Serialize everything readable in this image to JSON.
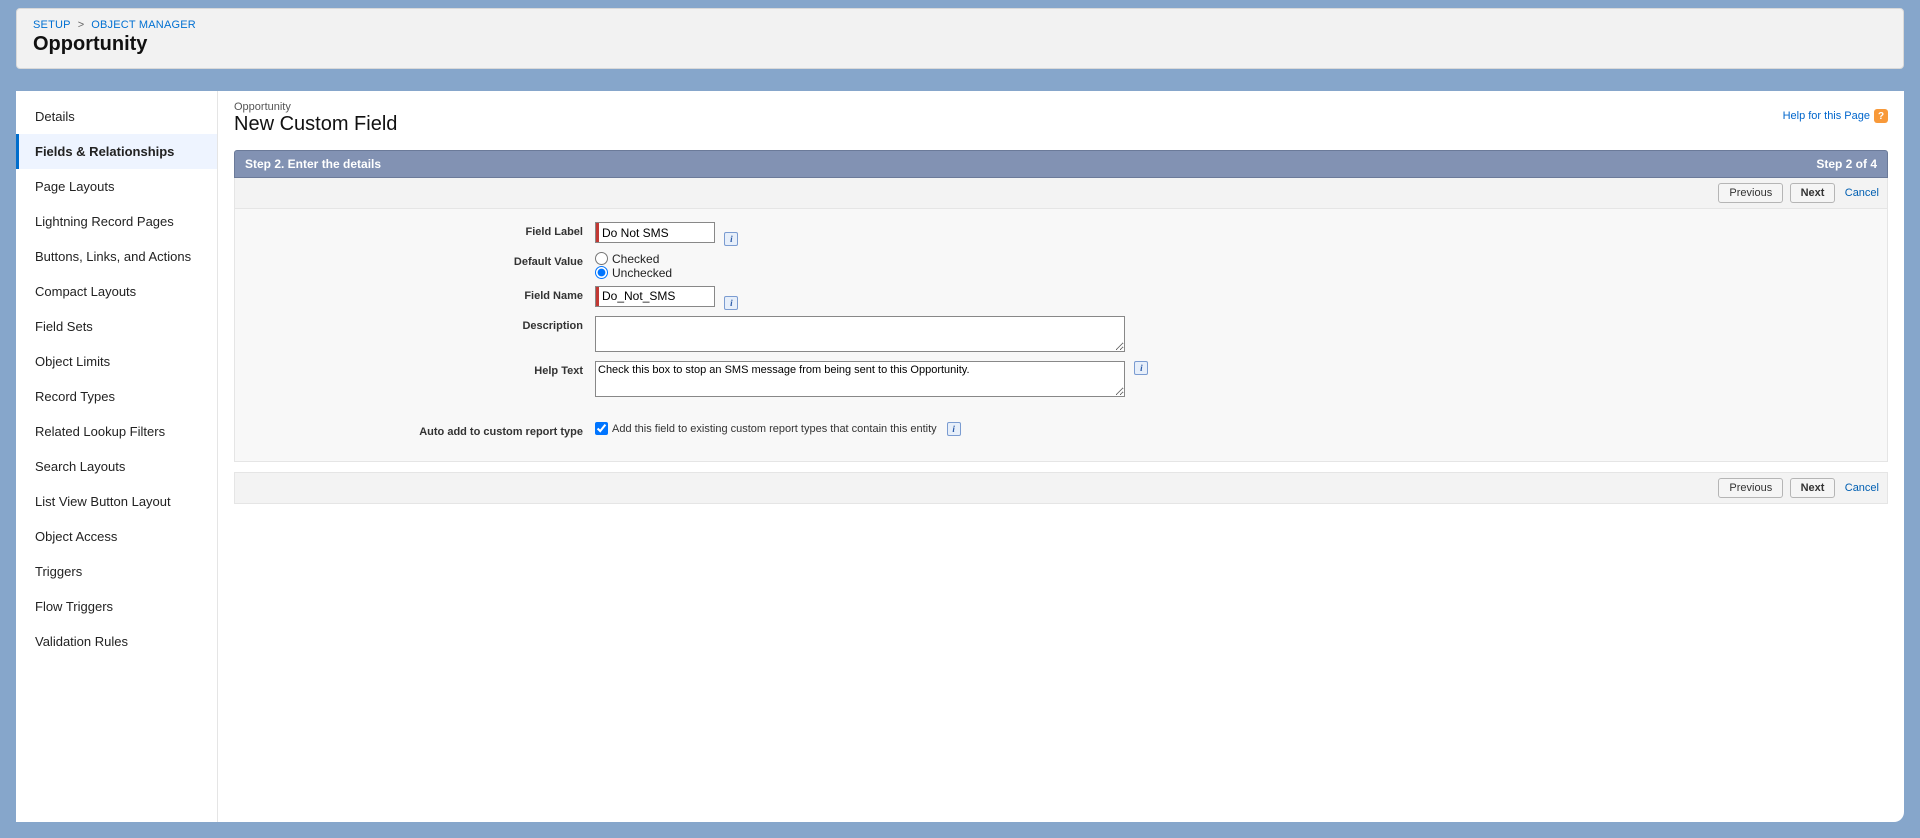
{
  "breadcrumb": {
    "setup": "SETUP",
    "object_manager": "OBJECT MANAGER",
    "sep": ">"
  },
  "page_object": "Opportunity",
  "sidebar": {
    "items": [
      "Details",
      "Fields & Relationships",
      "Page Layouts",
      "Lightning Record Pages",
      "Buttons, Links, and Actions",
      "Compact Layouts",
      "Field Sets",
      "Object Limits",
      "Record Types",
      "Related Lookup Filters",
      "Search Layouts",
      "List View Button Layout",
      "Object Access",
      "Triggers",
      "Flow Triggers",
      "Validation Rules"
    ],
    "active_index": 1
  },
  "content": {
    "sub_breadcrumb": "Opportunity",
    "page_title": "New Custom Field",
    "help_link": "Help for this Page",
    "step_header": "Step 2. Enter the details",
    "step_indicator": "Step 2 of 4",
    "buttons": {
      "previous": "Previous",
      "next": "Next",
      "cancel": "Cancel"
    }
  },
  "form": {
    "field_label_label": "Field Label",
    "field_label_value": "Do Not SMS",
    "default_value_label": "Default Value",
    "default_value_options": {
      "checked": "Checked",
      "unchecked": "Unchecked"
    },
    "field_name_label": "Field Name",
    "field_name_value": "Do_Not_SMS",
    "description_label": "Description",
    "description_value": "",
    "help_text_label": "Help Text",
    "help_text_value": "Check this box to stop an SMS message from being sent to this Opportunity.",
    "auto_add_label": "Auto add to custom report type",
    "auto_add_checkbox_label": "Add this field to existing custom report types that contain this entity",
    "info_glyph": "i"
  }
}
